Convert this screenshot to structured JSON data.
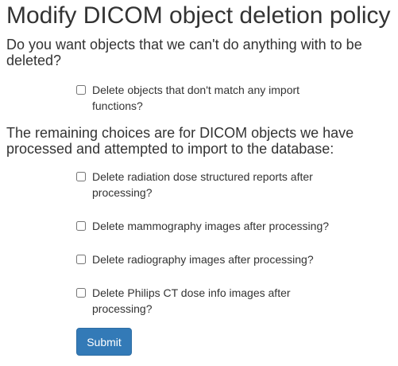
{
  "page": {
    "title": "Modify DICOM object deletion policy"
  },
  "intro": {
    "question": "Do you want objects that we can't do anything with to be deleted?"
  },
  "processed": {
    "heading": "The remaining choices are for DICOM objects we have processed and attempted to import to the database:"
  },
  "options": {
    "unmatched": {
      "label": "Delete objects that don't match any import functions?",
      "checked": false
    },
    "sr": {
      "label": "Delete radiation dose structured reports after processing?",
      "checked": false
    },
    "mammo": {
      "label": "Delete mammography images after processing?",
      "checked": false
    },
    "dx": {
      "label": "Delete radiography images after processing?",
      "checked": false
    },
    "philips": {
      "label": "Delete Philips CT dose info images after processing?",
      "checked": false
    }
  },
  "form": {
    "submit_label": "Submit"
  },
  "colors": {
    "button_bg": "#337ab7",
    "button_border": "#2e6da4",
    "text": "#333333"
  }
}
